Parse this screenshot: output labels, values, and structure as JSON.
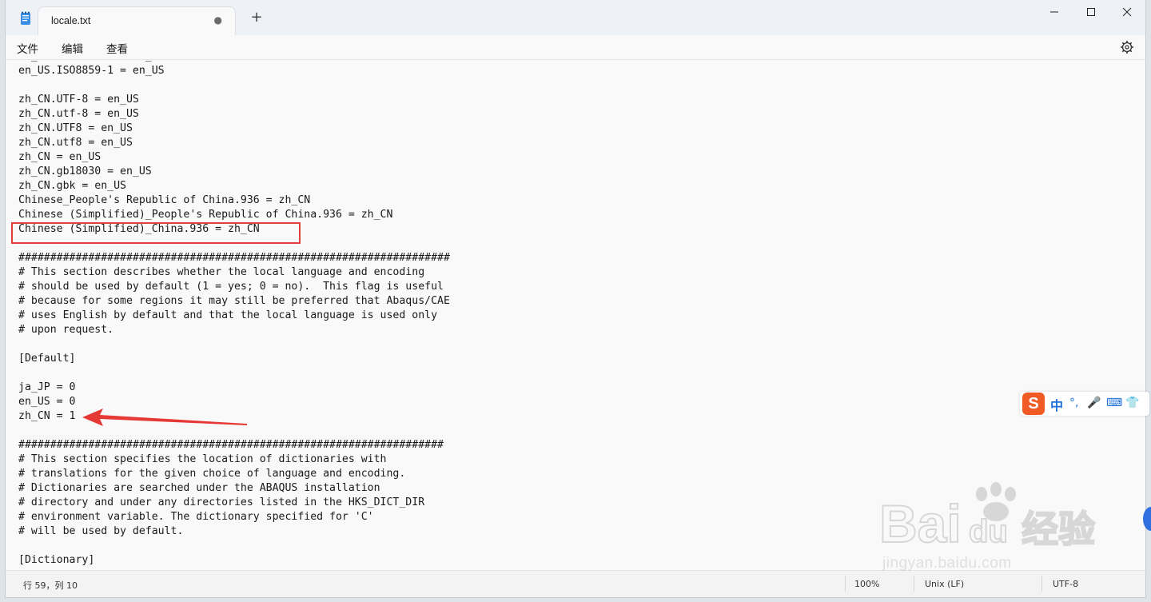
{
  "window": {
    "tab_title": "locale.txt",
    "tab_modified_indicator": "●",
    "new_tab_label": "+",
    "controls": {
      "minimize": "─",
      "maximize": "☐",
      "close": "✕"
    }
  },
  "menu": {
    "file": "文件",
    "edit": "编辑",
    "view": "查看"
  },
  "editor": {
    "lines": [
      "en_US.ISO8859-1 = en_US",
      "en_US.ISO8859-1 = en_US",
      "",
      "zh_CN.UTF-8 = en_US",
      "zh_CN.utf-8 = en_US",
      "zh_CN.UTF8 = en_US",
      "zh_CN.utf8 = en_US",
      "zh_CN = en_US",
      "zh_CN.gb18030 = en_US",
      "zh_CN.gbk = en_US",
      "Chinese_People's Republic of China.936 = zh_CN",
      "Chinese (Simplified)_People's Republic of China.936 = zh_CN",
      "Chinese (Simplified)_China.936 = zh_CN",
      "",
      "####################################################################",
      "# This section describes whether the local language and encoding",
      "# should be used by default (1 = yes; 0 = no).  This flag is useful",
      "# because for some regions it may still be preferred that Abaqus/CAE",
      "# uses English by default and that the local language is used only",
      "# upon request.",
      "",
      "[Default]",
      "",
      "ja_JP = 0",
      "en_US = 0",
      "zh_CN = 1",
      "",
      "###################################################################",
      "# This section specifies the location of dictionaries with",
      "# translations for the given choice of language and encoding.",
      "# Dictionaries are searched under the ABAQUS installation",
      "# directory and under any directories listed in the HKS_DICT_DIR",
      "# environment variable. The dictionary specified for 'C'",
      "# will be used by default.",
      "",
      "[Dictionary]"
    ]
  },
  "status": {
    "position": "行 59，列 10",
    "zoom": "100%",
    "line_ending": "Unix (LF)",
    "encoding": "UTF-8"
  },
  "ime": {
    "logo": "S",
    "mode": "中",
    "punct": "°,",
    "mic": "🎤",
    "keyboard": "⌨",
    "skin": "👕"
  },
  "watermark": {
    "brand": "Bai du 经验",
    "url": "jingyan.baidu.com"
  },
  "colors": {
    "highlight_box": "#e0413b",
    "arrow": "#e53935",
    "ime_accent": "#1e6fd9",
    "ime_logo": "#f05a24"
  }
}
